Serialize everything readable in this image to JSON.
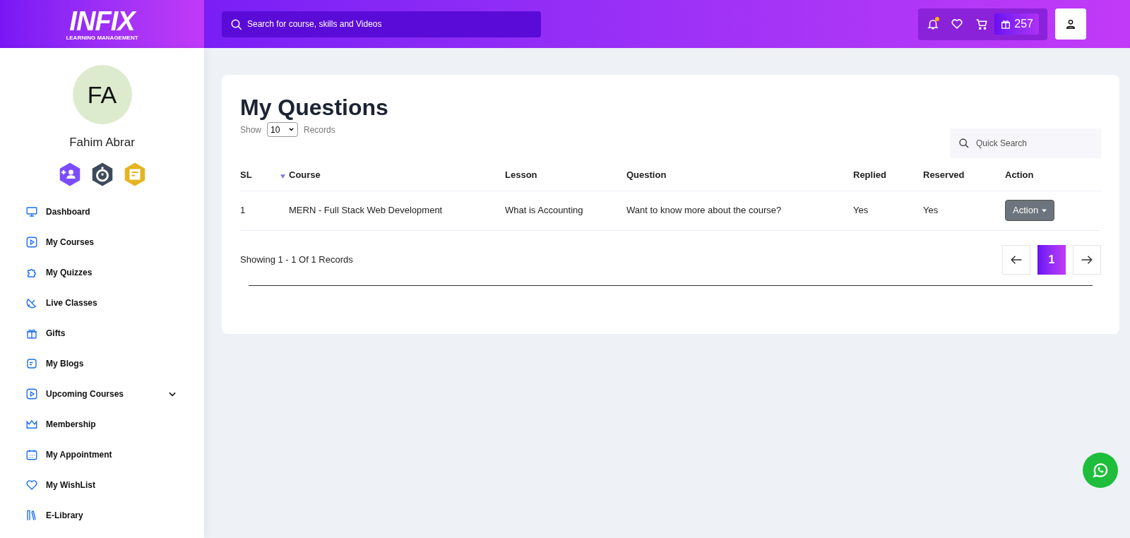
{
  "header": {
    "logo": {
      "title": "INFIX",
      "subtitle": "LEARNING MANAGEMENT"
    },
    "search": {
      "placeholder": "Search for course, skills and Videos"
    },
    "notification_dot": true,
    "points": "257"
  },
  "profile": {
    "initials": "FA",
    "name": "Fahim Abrar",
    "badges": [
      {
        "color": "#7c4dff"
      },
      {
        "color": "#3d4a5c"
      },
      {
        "color": "#e6b422"
      }
    ]
  },
  "sidebar": {
    "items": [
      {
        "label": "Dashboard"
      },
      {
        "label": "My Courses"
      },
      {
        "label": "My Quizzes"
      },
      {
        "label": "Live Classes"
      },
      {
        "label": "Gifts"
      },
      {
        "label": "My Blogs"
      },
      {
        "label": "Upcoming Courses",
        "expanded": false
      },
      {
        "label": "Membership"
      },
      {
        "label": "My Appointment"
      },
      {
        "label": "My WishList"
      },
      {
        "label": "E-Library"
      }
    ]
  },
  "main": {
    "title": "My Questions",
    "show_label": "Show",
    "page_size": "10",
    "records_label": "Records",
    "quick_search": {
      "placeholder": "Quick Search"
    },
    "table": {
      "columns": [
        "SL",
        "Course",
        "Lesson",
        "Question",
        "Replied",
        "Reserved",
        "Action"
      ],
      "rows": [
        {
          "sl": "1",
          "course": "MERN - Full Stack Web Development",
          "lesson": "What is Accounting",
          "question": "Want to know more about the course?",
          "replied": "Yes",
          "reserved": "Yes",
          "action": "Action"
        }
      ]
    },
    "summary": "Showing 1 - 1 Of 1 Records",
    "pages": [
      {
        "label": "1",
        "selected": true
      }
    ]
  }
}
